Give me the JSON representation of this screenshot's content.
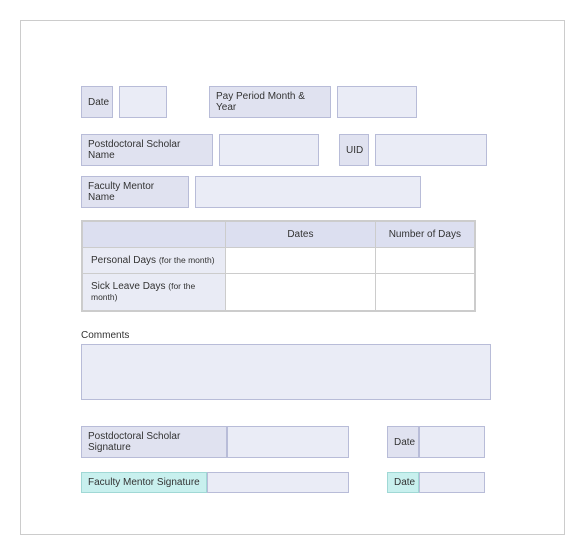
{
  "topRow": {
    "dateLabel": "Date",
    "dateValue": "",
    "payPeriodLabel": "Pay Period Month & Year",
    "payPeriodValue": ""
  },
  "nameRow": {
    "scholarLabel": "Postdoctoral Scholar Name",
    "scholarValue": "",
    "uidLabel": "UID",
    "uidValue": ""
  },
  "mentorRow": {
    "mentorLabel": "Faculty Mentor Name",
    "mentorValue": ""
  },
  "table": {
    "headers": {
      "blank": "",
      "dates": "Dates",
      "numDays": "Number of Days"
    },
    "rows": [
      {
        "label": "Personal Days (for the month)",
        "dates": "",
        "numDays": ""
      },
      {
        "label": "Sick Leave Days (for the month)",
        "dates": "",
        "numDays": ""
      }
    ]
  },
  "comments": {
    "label": "Comments",
    "value": ""
  },
  "sig1": {
    "scholarSigLabel": "Postdoctoral Scholar Signature",
    "scholarSigValue": "",
    "dateLabel": "Date",
    "dateValue": ""
  },
  "sig2": {
    "mentorSigLabel": "Faculty Mentor Signature",
    "mentorSigValue": "",
    "dateLabel": "Date",
    "dateValue": ""
  }
}
